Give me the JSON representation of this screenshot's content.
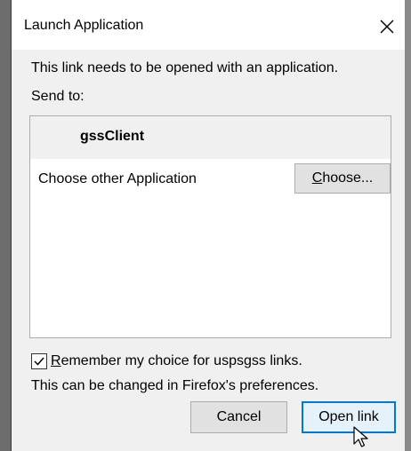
{
  "dialog": {
    "title": "Launch Application",
    "intro": "This link needs to be opened with an application.",
    "send_to_label": "Send to:"
  },
  "app_list": {
    "selected_app": "gssClient",
    "choose_other_label": "Choose other Application",
    "choose_button_accesskey": "C",
    "choose_button_rest": "hoose..."
  },
  "remember": {
    "checked": true,
    "accesskey": "R",
    "label_rest": "emember my choice for uspsgss links."
  },
  "note": "This can be changed in Firefox's preferences.",
  "buttons": {
    "cancel": "Cancel",
    "open": "Open link"
  },
  "icons": {
    "close": "close-icon",
    "checkbox": "checkmark-icon",
    "cursor": "mouse-pointer-icon"
  },
  "colors": {
    "focus_border": "#0078d7",
    "focus_fill": "#e5f1fb"
  }
}
